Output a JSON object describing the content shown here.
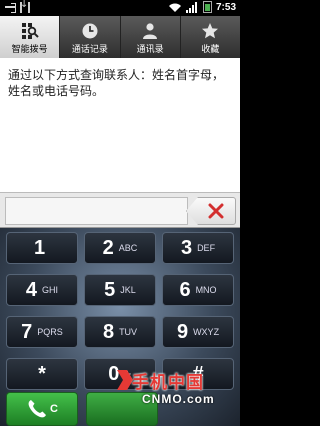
{
  "status_bar": {
    "time": "7:53"
  },
  "tabs": [
    {
      "label": "智能拨号",
      "icon": "smart-dial-icon",
      "active": true
    },
    {
      "label": "通话记录",
      "icon": "clock-icon",
      "active": false
    },
    {
      "label": "通讯录",
      "icon": "person-icon",
      "active": false
    },
    {
      "label": "收藏",
      "icon": "star-icon",
      "active": false
    }
  ],
  "hint": "通过以下方式查询联系人：姓名首字母，姓名或电话号码。",
  "input": {
    "value": "",
    "placeholder": ""
  },
  "keys": [
    {
      "digit": "1",
      "letters": ""
    },
    {
      "digit": "2",
      "letters": "ABC"
    },
    {
      "digit": "3",
      "letters": "DEF"
    },
    {
      "digit": "4",
      "letters": "GHI"
    },
    {
      "digit": "5",
      "letters": "JKL"
    },
    {
      "digit": "6",
      "letters": "MNO"
    },
    {
      "digit": "7",
      "letters": "PQRS"
    },
    {
      "digit": "8",
      "letters": "TUV"
    },
    {
      "digit": "9",
      "letters": "WXYZ"
    },
    {
      "digit": "*",
      "letters": ""
    },
    {
      "digit": "0",
      "letters": "+"
    },
    {
      "digit": "#",
      "letters": ""
    }
  ],
  "call_buttons": {
    "dial_badge": "C"
  },
  "watermark": {
    "title": "手机中国",
    "sub": "CNMO.com"
  },
  "colors": {
    "accent_green": "#2e9a35",
    "delete_red": "#d32f2f",
    "watermark_red": "#e53935"
  }
}
